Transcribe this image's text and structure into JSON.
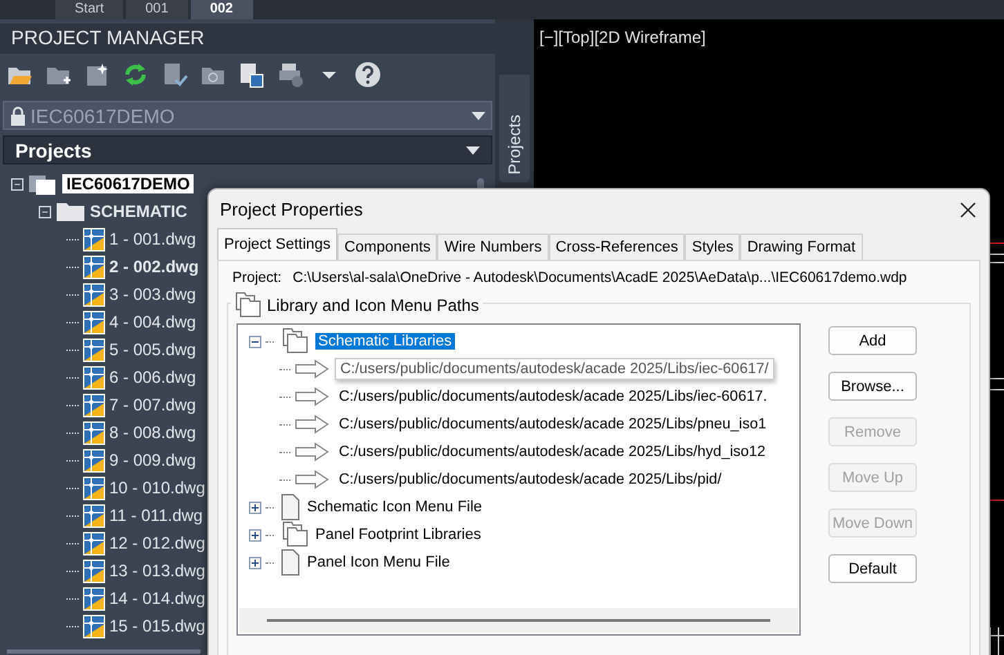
{
  "tabs": [
    {
      "label": "Start",
      "selected": false
    },
    {
      "label": "001",
      "selected": false
    },
    {
      "label": "002",
      "selected": true
    }
  ],
  "project_manager": {
    "title": "PROJECT MANAGER",
    "project_dropdown": {
      "value": "IEC60617DEMO"
    },
    "projects_header": "Projects",
    "tree": [
      {
        "label": "IEC60617DEMO",
        "kind": "project",
        "selected": true,
        "expanded": true,
        "children": [
          {
            "label": "SCHEMATIC",
            "kind": "folder",
            "selected": false,
            "expanded": true,
            "children": [
              {
                "label": "1 - 001.dwg",
                "kind": "drawing",
                "active": false
              },
              {
                "label": "2 - 002.dwg",
                "kind": "drawing",
                "active": true
              },
              {
                "label": "3 - 003.dwg",
                "kind": "drawing",
                "active": false
              },
              {
                "label": "4 - 004.dwg",
                "kind": "drawing",
                "active": false
              },
              {
                "label": "5 - 005.dwg",
                "kind": "drawing",
                "active": false
              },
              {
                "label": "6 - 006.dwg",
                "kind": "drawing",
                "active": false
              },
              {
                "label": "7 - 007.dwg",
                "kind": "drawing",
                "active": false
              },
              {
                "label": "8 - 008.dwg",
                "kind": "drawing",
                "active": false
              },
              {
                "label": "9 - 009.dwg",
                "kind": "drawing",
                "active": false
              },
              {
                "label": "10 - 010.dwg",
                "kind": "drawing",
                "active": false
              },
              {
                "label": "11 - 011.dwg",
                "kind": "drawing",
                "active": false
              },
              {
                "label": "12 - 012.dwg",
                "kind": "drawing",
                "active": false
              },
              {
                "label": "13 - 013.dwg",
                "kind": "drawing",
                "active": false
              },
              {
                "label": "14 - 014.dwg",
                "kind": "drawing",
                "active": false
              },
              {
                "label": "15 - 015.dwg",
                "kind": "drawing",
                "active": false
              }
            ]
          }
        ]
      }
    ]
  },
  "side_tab": "Projects",
  "viewport": {
    "label": "[−][Top][2D Wireframe]"
  },
  "dialog": {
    "title": "Project Properties",
    "tabs": [
      {
        "label": "Project Settings",
        "selected": true
      },
      {
        "label": "Components",
        "selected": false
      },
      {
        "label": "Wire Numbers",
        "selected": false
      },
      {
        "label": "Cross-References",
        "selected": false
      },
      {
        "label": "Styles",
        "selected": false
      },
      {
        "label": "Drawing Format",
        "selected": false
      }
    ],
    "project_label": "Project:",
    "project_path": "C:\\Users\\al-sala\\OneDrive - Autodesk\\Documents\\AcadE 2025\\AeData\\p...\\IEC60617demo.wdp",
    "group_title": "Library and Icon Menu Paths",
    "tree": [
      {
        "label": "Schematic Libraries",
        "kind": "folders",
        "expanded": true,
        "selected": true,
        "children": [
          {
            "label": "C:/users/public/documents/autodesk/acade 2025/Libs/iec-60617/",
            "kind": "path",
            "hovered": true
          },
          {
            "label": "C:/users/public/documents/autodesk/acade 2025/Libs/iec-60617.",
            "kind": "path",
            "hovered": false
          },
          {
            "label": "C:/users/public/documents/autodesk/acade 2025/Libs/pneu_iso1",
            "kind": "path",
            "hovered": false
          },
          {
            "label": "C:/users/public/documents/autodesk/acade 2025/Libs/hyd_iso12",
            "kind": "path",
            "hovered": false
          },
          {
            "label": "C:/users/public/documents/autodesk/acade 2025/Libs/pid/",
            "kind": "path",
            "hovered": false
          }
        ]
      },
      {
        "label": "Schematic Icon Menu File",
        "kind": "file",
        "expanded": false,
        "selected": false
      },
      {
        "label": "Panel Footprint Libraries",
        "kind": "folders",
        "expanded": false,
        "selected": false
      },
      {
        "label": "Panel Icon Menu File",
        "kind": "file",
        "expanded": false,
        "selected": false
      }
    ],
    "buttons": [
      {
        "label": "Add",
        "disabled": false
      },
      {
        "label": "Browse...",
        "disabled": false
      },
      {
        "label": "Remove",
        "disabled": true
      },
      {
        "label": "Move Up",
        "disabled": true
      },
      {
        "label": "Move Down",
        "disabled": true
      },
      {
        "label": "Default",
        "disabled": false
      }
    ]
  }
}
